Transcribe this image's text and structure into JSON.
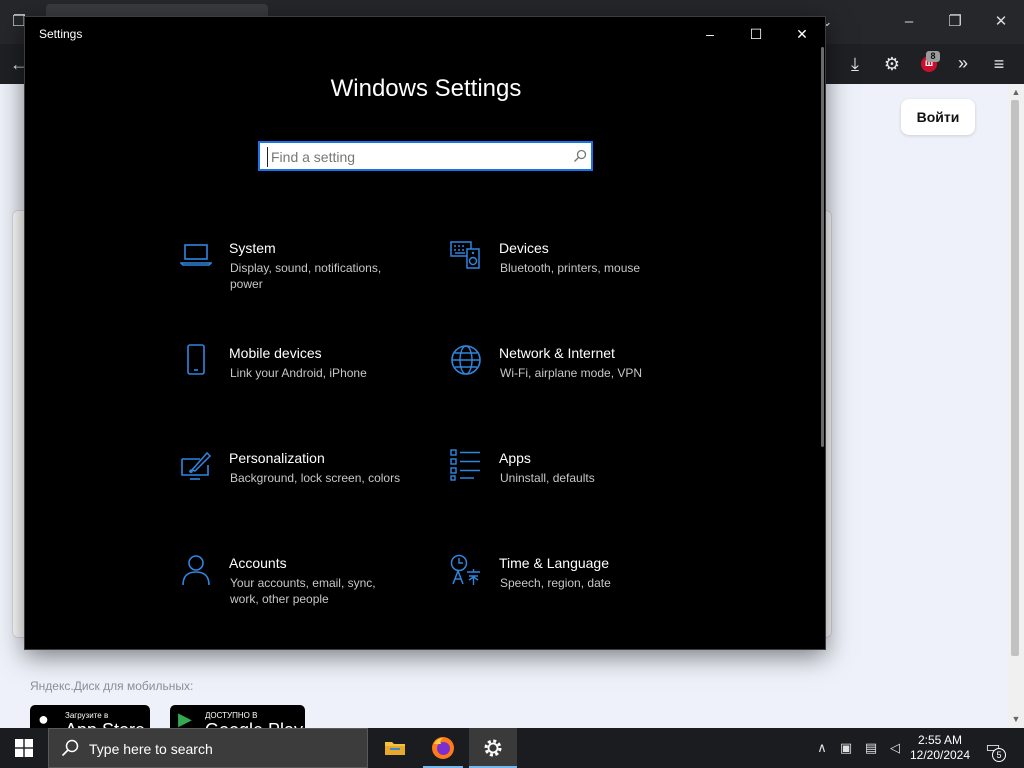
{
  "browser": {
    "login_label": "Войти",
    "extension_badge": "8",
    "extension_logo": "ш",
    "disk_mobile_label": "Яндекс.Диск для мобильных:",
    "app_store": {
      "small": "Загрузите в",
      "big": "App Store"
    },
    "google_play": {
      "small": "ДОСТУПНО В",
      "big": "Google Play"
    }
  },
  "settings_window": {
    "title": "Settings",
    "heading": "Windows Settings",
    "search_placeholder": "Find a setting",
    "accent_color": "#1a73e8",
    "categories": [
      {
        "name": "System",
        "desc": "Display, sound, notifications, power",
        "icon": "laptop-icon"
      },
      {
        "name": "Devices",
        "desc": "Bluetooth, printers, mouse",
        "icon": "keyboard-speaker-icon"
      },
      {
        "name": "Mobile devices",
        "desc": "Link your Android, iPhone",
        "icon": "phone-icon"
      },
      {
        "name": "Network & Internet",
        "desc": "Wi-Fi, airplane mode, VPN",
        "icon": "globe-icon"
      },
      {
        "name": "Personalization",
        "desc": "Background, lock screen, colors",
        "icon": "paint-icon"
      },
      {
        "name": "Apps",
        "desc": "Uninstall, defaults",
        "icon": "apps-list-icon"
      },
      {
        "name": "Accounts",
        "desc": "Your accounts, email, sync, work, other people",
        "icon": "person-icon"
      },
      {
        "name": "Time & Language",
        "desc": "Speech, region, date",
        "icon": "time-language-icon"
      }
    ]
  },
  "taskbar": {
    "search_placeholder": "Type here to search",
    "time": "2:55 AM",
    "date": "12/20/2024",
    "notification_count": "5"
  }
}
